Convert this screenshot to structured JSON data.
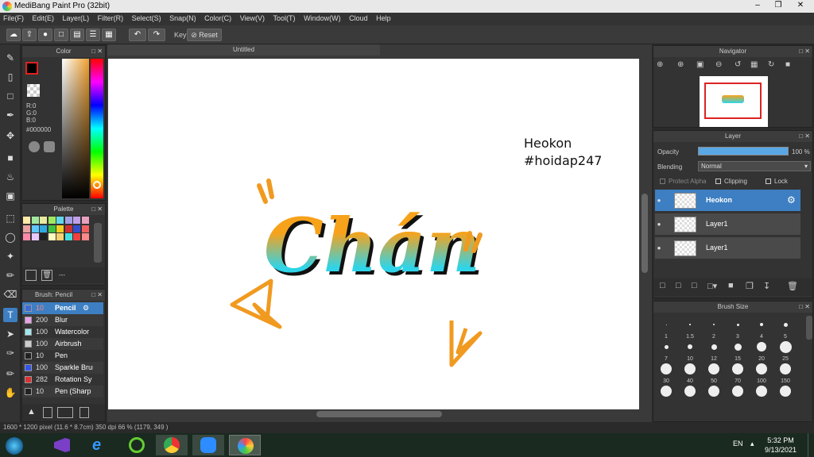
{
  "app": {
    "title": "MediBang Paint Pro (32bit)"
  },
  "menu": [
    "File(F)",
    "Edit(E)",
    "Layer(L)",
    "Filter(R)",
    "Select(S)",
    "Snap(N)",
    "Color(C)",
    "View(V)",
    "Tool(T)",
    "Window(W)",
    "Cloud",
    "Help"
  ],
  "toolbar": {
    "key_label": "Key",
    "reset_label": "Reset"
  },
  "color_panel": {
    "title": "Color",
    "r": "R:0",
    "g": "G:0",
    "b": "B:0",
    "hex": "#000000"
  },
  "palette_panel": {
    "title": "Palette",
    "extra": "---"
  },
  "brush_panel": {
    "title": "Brush: Pencil",
    "items": [
      {
        "size": "10",
        "name": "Pencil",
        "color": "#3a6bd8"
      },
      {
        "size": "200",
        "name": "Blur",
        "color": "#e8a0e8"
      },
      {
        "size": "100",
        "name": "Watercolor",
        "color": "#a0e8f0"
      },
      {
        "size": "100",
        "name": "Airbrush",
        "color": "#cccccc"
      },
      {
        "size": "10",
        "name": "Pen",
        "color": "#222222"
      },
      {
        "size": "100",
        "name": "Sparkle Brus",
        "color": "#3355ee"
      },
      {
        "size": "282",
        "name": "Rotation Sy",
        "color": "#e03030"
      },
      {
        "size": "10",
        "name": "Pen (Sharp",
        "color": "#222222"
      }
    ]
  },
  "canvas": {
    "tab_title": "Untitled",
    "text_line1": "Heokon",
    "text_line2": "#hoidap247",
    "lettering": "Chán"
  },
  "navigator": {
    "title": "Navigator"
  },
  "layer_panel": {
    "title": "Layer",
    "opacity_label": "Opacity",
    "opacity_value": "100 %",
    "blending_label": "Blending",
    "blending_value": "Normal",
    "protect_alpha": "Protect Alpha",
    "clipping": "Clipping",
    "lock": "Lock",
    "layers": [
      {
        "name": "Heokon",
        "selected": true
      },
      {
        "name": "Layer1",
        "selected": false
      },
      {
        "name": "Layer1",
        "selected": false
      }
    ]
  },
  "brush_size_panel": {
    "title": "Brush Size",
    "sizes": [
      "1",
      "1.5",
      "2",
      "3",
      "4",
      "5",
      "7",
      "10",
      "12",
      "15",
      "20",
      "25",
      "30",
      "40",
      "50",
      "70",
      "100",
      "150"
    ]
  },
  "status": {
    "size": "1600 * 1200 pixel",
    "cm": "(11.6 * 8.7cm)",
    "dpi": "350 dpi",
    "zoom": "66 %",
    "coords": "(1179, 349 )"
  },
  "taskbar": {
    "lang": "EN",
    "time": "5:32 PM",
    "date": "9/13/2021"
  },
  "colors": {
    "accent": "#3d7fc2",
    "orange": "#f0a020",
    "cyan": "#2fd4e8"
  }
}
